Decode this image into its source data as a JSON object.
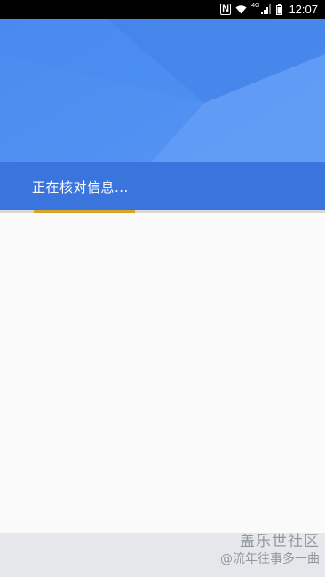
{
  "status_bar": {
    "nfc_icon": "N",
    "network_type": "4G",
    "time": "12:07",
    "icons": [
      "nfc-icon",
      "wifi-icon",
      "signal-icon",
      "battery-icon"
    ]
  },
  "header": {
    "status_text": "正在核对信息...",
    "colors": {
      "header_blue": "#4d8ef1",
      "band_blue": "#3a74dd",
      "progress_accent": "#d4a52a"
    }
  },
  "progress": {
    "indeterminate": true
  },
  "watermark": {
    "title": "盖乐世社区",
    "subtitle": "@流年往事多一曲"
  }
}
